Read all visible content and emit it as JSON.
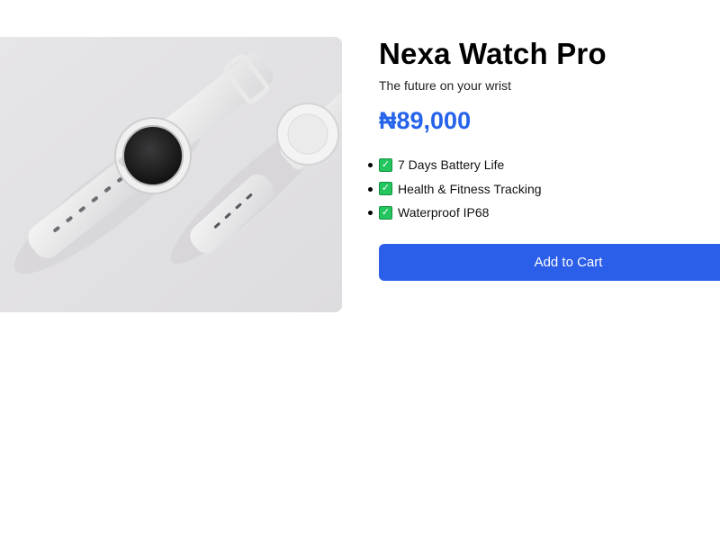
{
  "product": {
    "image_icon": "smartwatch-photo",
    "title": "Nexa Watch Pro",
    "tagline": "The future on your wrist",
    "price": "₦89,000",
    "features": [
      {
        "icon": "check-icon",
        "label": "7 Days Battery Life"
      },
      {
        "icon": "check-icon",
        "label": "Health & Fitness Tracking"
      },
      {
        "icon": "check-icon",
        "label": "Waterproof IP68"
      }
    ],
    "add_to_cart_label": "Add to Cart"
  },
  "colors": {
    "accent": "#2563eb",
    "button": "#2b5ee9",
    "check": "#22c55e",
    "image_bg": "#e2e1e3"
  }
}
